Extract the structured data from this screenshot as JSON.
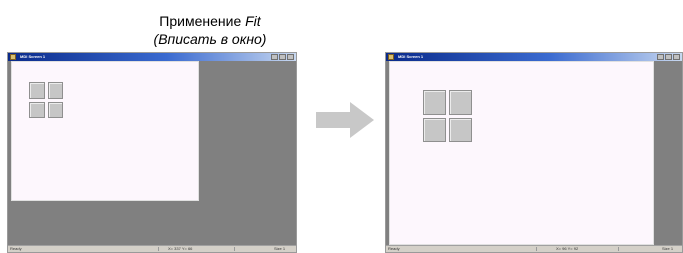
{
  "caption": {
    "line1_prefix": "Применение ",
    "line1_italic": "Fit",
    "line2": "(Вписать в окно)"
  },
  "windows": [
    {
      "title": "MDI Screen 1",
      "status": {
        "left": "Ready",
        "middle": "X= 337 Y= 66",
        "right": "Size 1"
      }
    },
    {
      "title": "MDI Screen 1",
      "status": {
        "left": "Ready",
        "middle": "X= 96 Y= 92",
        "right": "Size 1"
      }
    }
  ],
  "colors": {
    "arrow": "#c8c8c8",
    "workspace": "#808080",
    "canvas": "#fdf7fd",
    "tile": "#c6c6c6"
  }
}
